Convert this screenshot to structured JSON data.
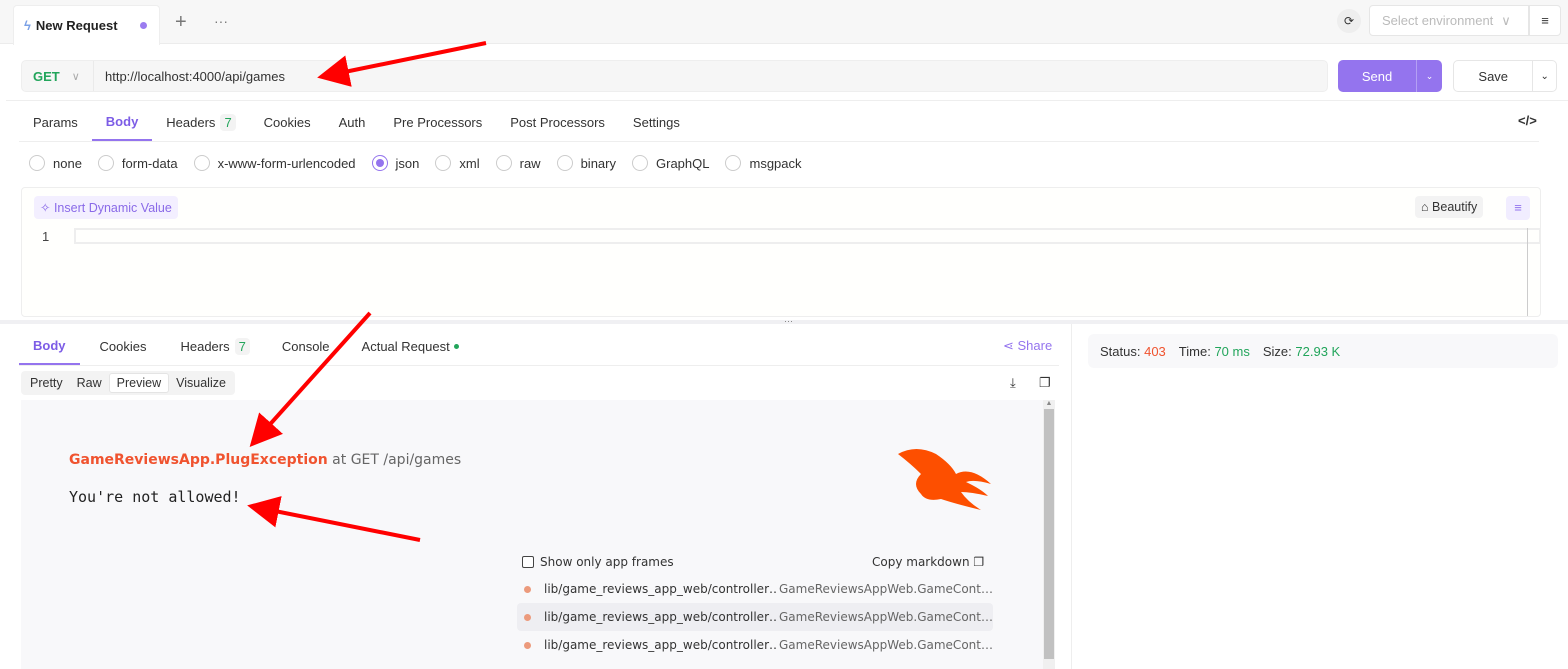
{
  "tab": {
    "title": "New Request",
    "add": "+",
    "more": "···"
  },
  "env": {
    "placeholder": "Select environment"
  },
  "request": {
    "method": "GET",
    "url": "http://localhost:4000/api/games",
    "send": "Send",
    "save": "Save"
  },
  "req_tabs": [
    {
      "label": "Params"
    },
    {
      "label": "Body"
    },
    {
      "label": "Headers",
      "badge": "7"
    },
    {
      "label": "Cookies"
    },
    {
      "label": "Auth"
    },
    {
      "label": "Pre Processors"
    },
    {
      "label": "Post Processors"
    },
    {
      "label": "Settings"
    }
  ],
  "body_types": [
    "none",
    "form-data",
    "x-www-form-urlencoded",
    "json",
    "xml",
    "raw",
    "binary",
    "GraphQL",
    "msgpack"
  ],
  "selected_body_type": "json",
  "editor": {
    "insert_dynamic": "Insert Dynamic Value",
    "beautify": "Beautify",
    "line": "1"
  },
  "resp_tabs": [
    {
      "label": "Body"
    },
    {
      "label": "Cookies"
    },
    {
      "label": "Headers",
      "badge": "7"
    },
    {
      "label": "Console"
    },
    {
      "label": "Actual Request"
    }
  ],
  "share": "Share",
  "view_modes": [
    "Pretty",
    "Raw",
    "Preview",
    "Visualize"
  ],
  "preview": {
    "exception": "GameReviewsApp.PlugException",
    "at": " at GET /api/games",
    "message": "You're not allowed!",
    "show_app_frames": "Show only app frames",
    "copy_markdown": "Copy markdown",
    "frames": [
      {
        "path": "lib/game_reviews_app_web/controller…",
        "module": "GameReviewsAppWeb.GameCont…"
      },
      {
        "path": "lib/game_reviews_app_web/controller…",
        "module": "GameReviewsAppWeb.GameCont…"
      },
      {
        "path": "lib/game_reviews_app_web/controller…",
        "module": "GameReviewsAppWeb.GameCont…"
      }
    ]
  },
  "status": {
    "status_label": "Status:",
    "status": "403",
    "time_label": "Time:",
    "time": "70 ms",
    "size_label": "Size:",
    "size": "72.93 K"
  },
  "colors": {
    "accent": "#9474ee",
    "success": "#22a55b",
    "error": "#f0532f",
    "annotation": "#ff0000"
  }
}
